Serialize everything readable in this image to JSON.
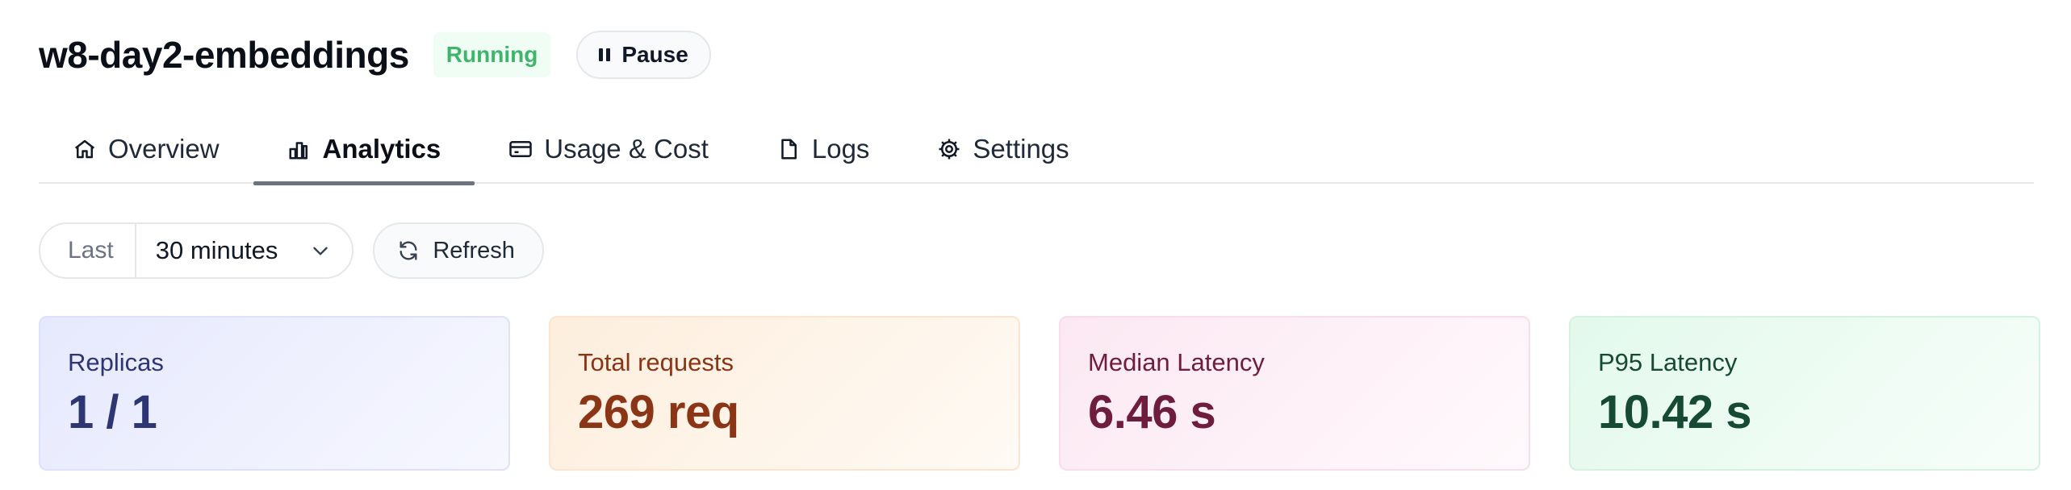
{
  "header": {
    "title": "w8-day2-embeddings",
    "status": "Running",
    "pause_label": "Pause"
  },
  "tabs": [
    {
      "label": "Overview",
      "icon": "home-icon"
    },
    {
      "label": "Analytics",
      "icon": "bar-chart-icon",
      "active": true
    },
    {
      "label": "Usage & Cost",
      "icon": "credit-card-icon"
    },
    {
      "label": "Logs",
      "icon": "file-icon"
    },
    {
      "label": "Settings",
      "icon": "gear-icon"
    }
  ],
  "controls": {
    "range_label": "Last",
    "range_value": "30 minutes",
    "refresh_label": "Refresh"
  },
  "cards": [
    {
      "label": "Replicas",
      "value": "1 / 1",
      "color": "#2e3573"
    },
    {
      "label": "Total requests",
      "value": "269 req",
      "color": "#8a3516"
    },
    {
      "label": "Median Latency",
      "value": "6.46 s",
      "color": "#6f1d3f"
    },
    {
      "label": "P95 Latency",
      "value": "10.42 s",
      "color": "#174a34"
    }
  ],
  "colors": {
    "status_text": "#3fb56b",
    "status_bg": "#f0fdf4",
    "tab_indicator": "#6b7280"
  }
}
